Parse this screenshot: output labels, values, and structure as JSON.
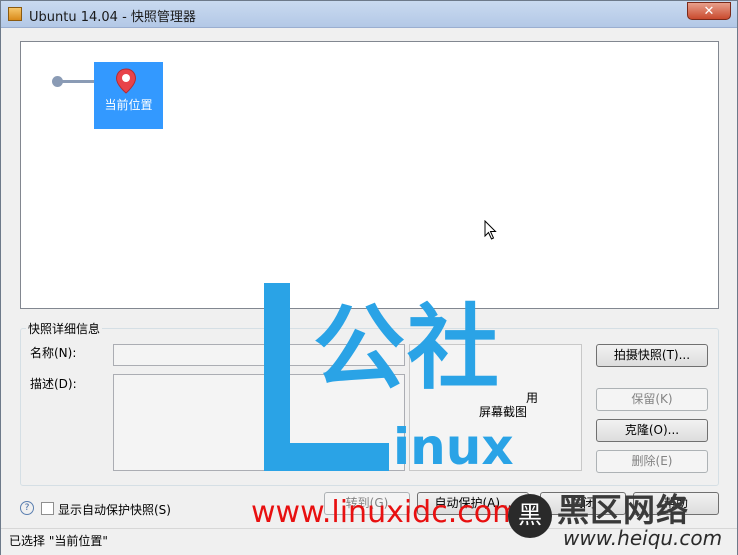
{
  "window": {
    "title": "Ubuntu 14.04 - 快照管理器",
    "close_glyph": "✕"
  },
  "tree": {
    "current_node_label": "当前位置"
  },
  "details": {
    "group_title": "快照详细信息",
    "name_label": "名称(N):",
    "name_value": "",
    "description_label": "描述(D):",
    "description_value": "",
    "screenshot_text_line1": "用",
    "screenshot_text_line2": "屏幕截图"
  },
  "side_buttons": {
    "take_snapshot": "拍摄快照(T)...",
    "keep": "保留(K)",
    "clone": "克隆(O)...",
    "delete": "删除(E)"
  },
  "bottom": {
    "show_autoprotect_label": "显示自动保护快照(S)",
    "goto_button": "转到(G)",
    "autoprotect_button": "自动保护(A)...",
    "close_button": "关闭",
    "help_button": "帮助"
  },
  "status": {
    "text": "已选择 \"当前位置\""
  },
  "watermark": {
    "gongshe": "公社",
    "inux": "inux",
    "url": "www.linuxidc.com",
    "heiqu_badge": "黑",
    "heiqu_cn": "黑区网络",
    "heiqu_url": "www.heiqu.com"
  },
  "colors": {
    "selection": "#3399ff",
    "pin": "#e8434a",
    "watermark_blue": "#2aa3e6",
    "watermark_red": "#e81010"
  },
  "icons": [
    "app-icon",
    "location-pin-icon",
    "mouse-cursor-icon",
    "help-icon"
  ]
}
